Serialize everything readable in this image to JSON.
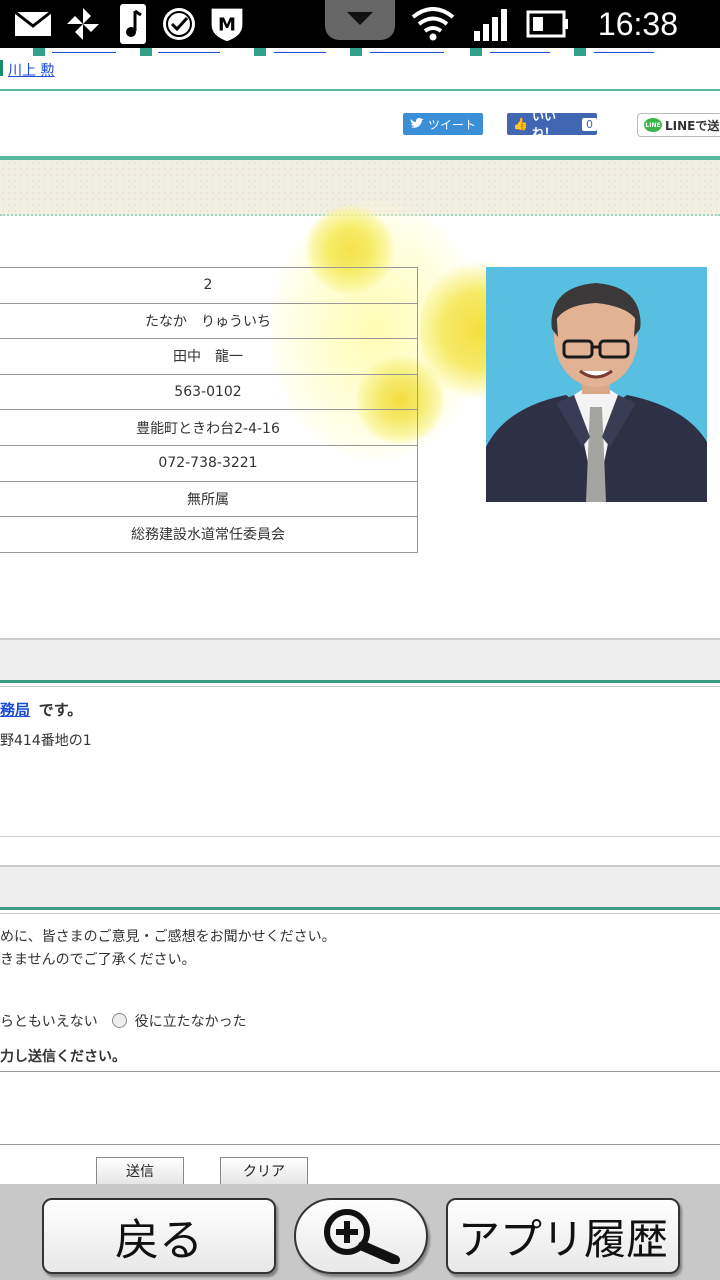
{
  "status_bar": {
    "time": "16:38"
  },
  "breadcrumb_link": "川上 勲",
  "social": {
    "tweet": "ツイート",
    "like": "いいね！",
    "like_count": "0",
    "line": "LINEで送"
  },
  "profile_table": [
    "2",
    "たなか　りゅういち",
    "田中　龍一",
    "563-0102",
    "豊能町ときわ台2-4-16",
    "072-738-3221",
    "無所属",
    "総務建設水道常任委員会"
  ],
  "contact": {
    "link_text": "務局",
    "suffix": "です。",
    "address": "野414番地の1"
  },
  "feedback": {
    "line1": "めに、皆さまのご意見・ご感想をお聞かせください。",
    "line2": "きませんのでご了承ください。",
    "option_partial": "らともいえない",
    "option_last": "役に立たなかった",
    "instruction": "力し送信ください。",
    "submit": "送信",
    "clear": "クリア"
  },
  "bottom_bar": {
    "back": "戻る",
    "history": "アプリ履歴",
    "zoom_icon": "zoom-in-magnifier-icon"
  }
}
